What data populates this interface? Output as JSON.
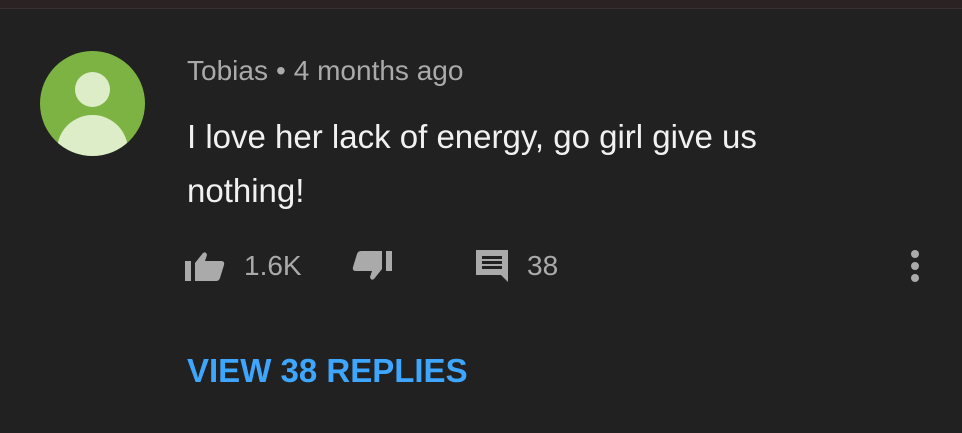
{
  "comment": {
    "author": "Tobias",
    "separator": "•",
    "timestamp": "4 months ago",
    "text": "I love her lack of energy, go girl give us nothing!",
    "likes": "1.6K",
    "replies_count": "38",
    "view_replies_label": "VIEW 38 REPLIES"
  },
  "icons": {
    "avatar": "default-user-avatar-icon",
    "like": "thumbs-up-icon",
    "dislike": "thumbs-down-icon",
    "reply": "comment-icon",
    "more": "more-vertical-icon"
  },
  "colors": {
    "background": "#212121",
    "avatar_bg": "#7cb342",
    "link": "#3ea6ff",
    "secondary_text": "#aaaaaa",
    "primary_text": "#f1f1f1"
  }
}
